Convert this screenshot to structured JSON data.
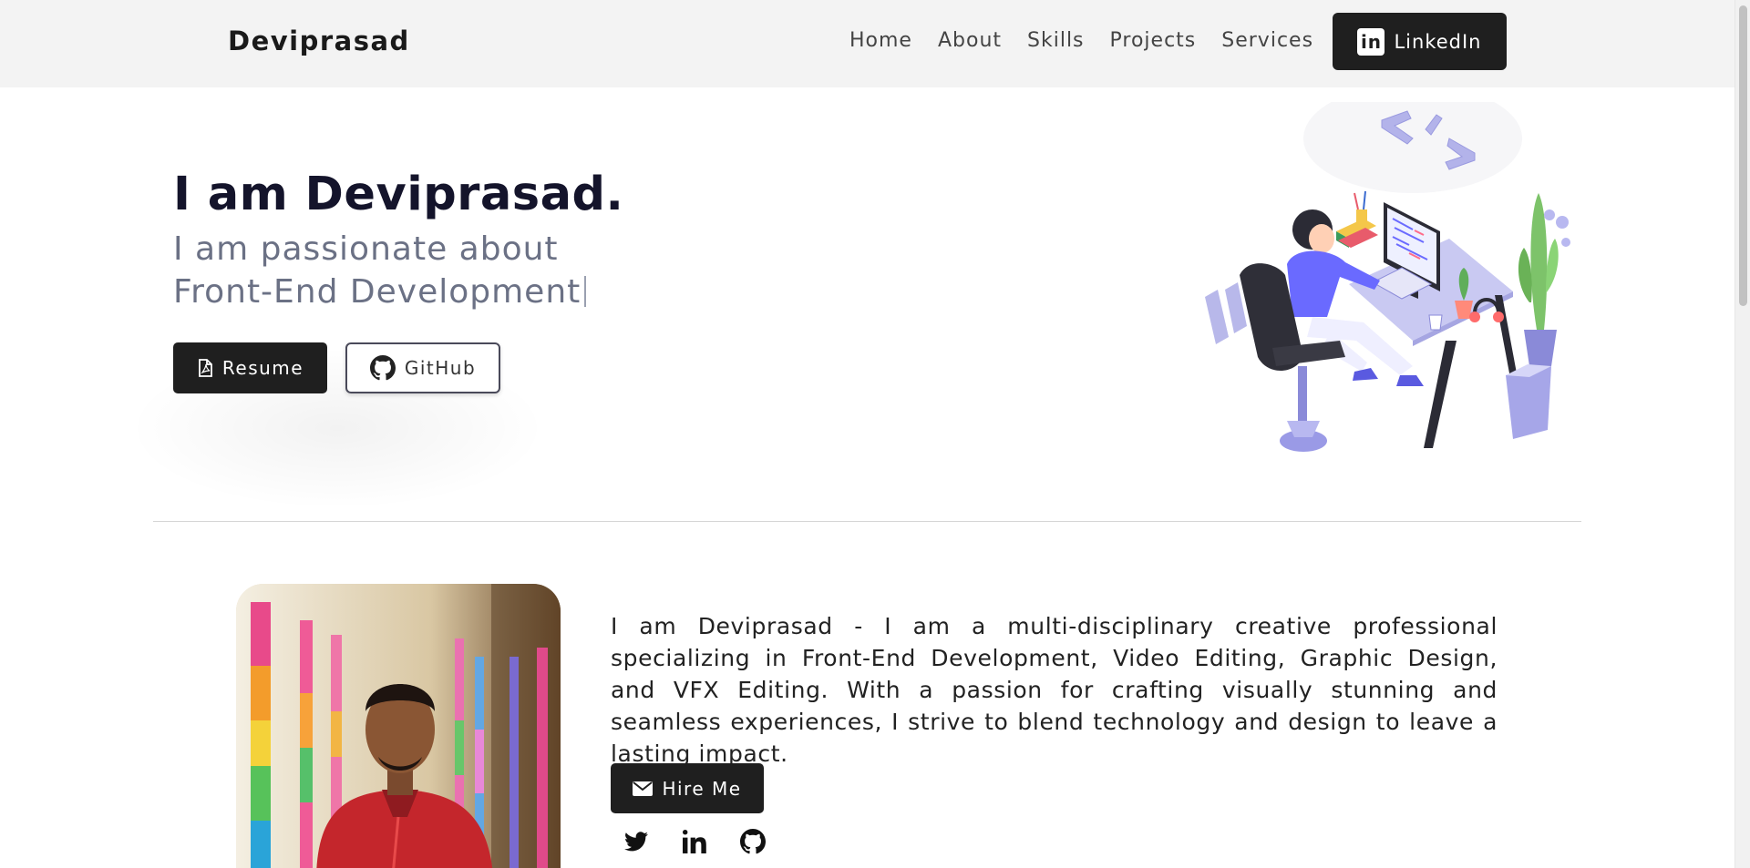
{
  "header": {
    "brand": "Deviprasad",
    "nav": [
      "Home",
      "About",
      "Skills",
      "Projects",
      "Services"
    ],
    "linkedin_label": "LinkedIn",
    "linkedin_badge": "in"
  },
  "hero": {
    "title": "I am Deviprasad.",
    "subtitle_line1": "I am passionate about",
    "subtitle_line2": "Front-End Development",
    "resume_label": "Resume",
    "github_label": "GitHub"
  },
  "about": {
    "text": "I am Deviprasad - I am a multi-disciplinary creative professional specializing in Front-End Development, Video Editing, Graphic Design, and VFX Editing. With a passion for crafting visually stunning and seamless experiences, I strive to blend technology and design to leave a lasting impact.",
    "hire_label": "Hire Me",
    "socials": [
      "twitter-icon",
      "linkedin-icon",
      "github-icon"
    ]
  },
  "colors": {
    "dark": "#1f1f1f",
    "nav_bg": "#f3f3f3",
    "subtitle": "#6b7185",
    "accent": "#7c7cf0"
  }
}
